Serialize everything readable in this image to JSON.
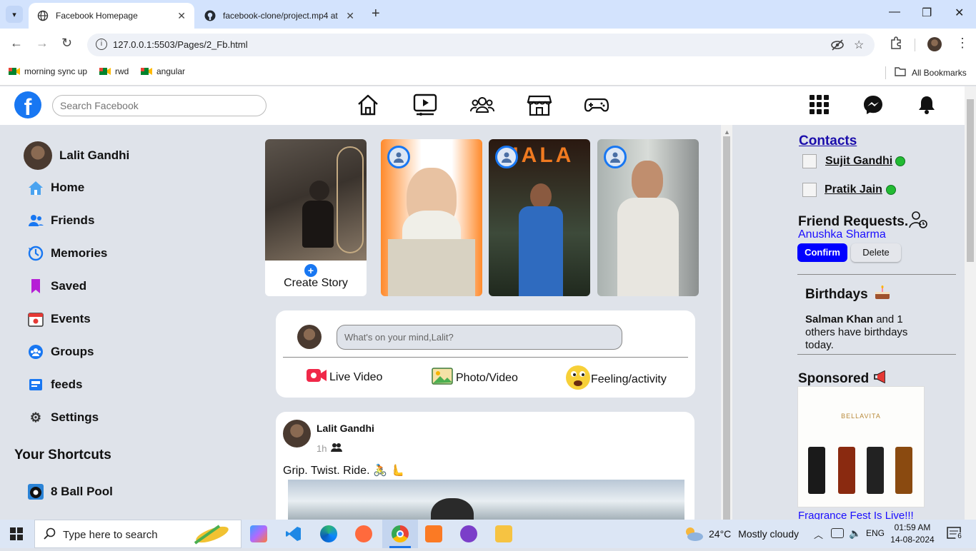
{
  "browser": {
    "tabs": [
      {
        "title": "Facebook Homepage",
        "active": true
      },
      {
        "title": "facebook-clone/project.mp4 at",
        "active": false
      }
    ],
    "url": "127.0.0.1:5503/Pages/2_Fb.html",
    "bookmarks": [
      "morning sync up",
      "rwd",
      "angular"
    ],
    "all_bookmarks": "All Bookmarks"
  },
  "header": {
    "search_placeholder": "Search Facebook"
  },
  "sidebar": {
    "user_name": "Lalit Gandhi",
    "items": [
      {
        "label": "Home",
        "icon": "home-icon"
      },
      {
        "label": "Friends",
        "icon": "friends-icon"
      },
      {
        "label": "Memories",
        "icon": "memories-icon"
      },
      {
        "label": "Saved",
        "icon": "saved-icon"
      },
      {
        "label": "Events",
        "icon": "events-icon"
      },
      {
        "label": "Groups",
        "icon": "groups-icon"
      },
      {
        "label": "feeds",
        "icon": "feeds-icon"
      },
      {
        "label": "Settings",
        "icon": "settings-icon"
      }
    ],
    "shortcuts_title": "Your Shortcuts",
    "shortcuts": [
      {
        "label": "8 Ball Pool"
      }
    ]
  },
  "stories": {
    "create_label": "Create Story",
    "story3_caption": "HALA"
  },
  "composer": {
    "placeholder": "What's on your mind,Lalit?",
    "actions": [
      "Live Video",
      "Photo/Video",
      "Feeling/activity"
    ]
  },
  "post": {
    "author": "Lalit Gandhi",
    "time": "1h",
    "text": "Grip. Twist. Ride. 🚴 🫷"
  },
  "right": {
    "contacts_title": "Contacts",
    "contacts": [
      "Sujit Gandhi",
      "Pratik Jain"
    ],
    "friend_requests_title": "Friend Requests.",
    "request_name": "Anushka Sharma",
    "confirm_label": "Confirm",
    "delete_label": "Delete",
    "birthdays_title": "Birthdays",
    "birthday_name": "Salman Khan",
    "birthday_rest": " and 1 others have birthdays today.",
    "sponsored_title": "Sponsored",
    "brand": "BELLAVITA",
    "sponsored_link": "Fragrance Fest Is Live!!!"
  },
  "taskbar": {
    "search_placeholder": "Type here to search",
    "weather_temp": "24°C",
    "weather_desc": "Mostly cloudy",
    "lang": "ENG",
    "time": "01:59 AM",
    "date": "14-08-2024",
    "notifications": "6"
  },
  "colors": {
    "fb_blue": "#1877f2",
    "confirm_blue": "#0000ff",
    "online_green": "#22bb33"
  }
}
